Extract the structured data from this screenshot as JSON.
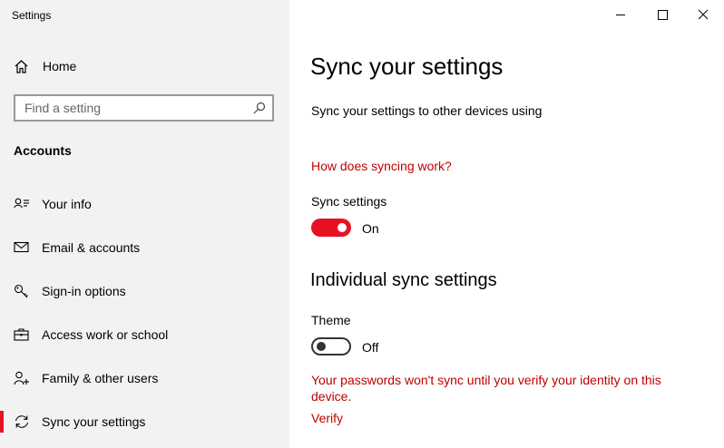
{
  "window": {
    "title": "Settings"
  },
  "sidebar": {
    "home_label": "Home",
    "search_placeholder": "Find a setting",
    "section_title": "Accounts",
    "items": [
      {
        "label": "Your info",
        "icon": "person-card-icon"
      },
      {
        "label": "Email & accounts",
        "icon": "mail-icon"
      },
      {
        "label": "Sign-in options",
        "icon": "key-icon"
      },
      {
        "label": "Access work or school",
        "icon": "briefcase-icon"
      },
      {
        "label": "Family & other users",
        "icon": "person-add-icon"
      },
      {
        "label": "Sync your settings",
        "icon": "sync-icon",
        "active": true
      }
    ]
  },
  "main": {
    "title": "Sync your settings",
    "description": "Sync your settings to other devices using",
    "help_link": "How does syncing work?",
    "sync_settings": {
      "label": "Sync settings",
      "state": "On",
      "on": true
    },
    "individual_heading": "Individual sync settings",
    "theme": {
      "label": "Theme",
      "state": "Off",
      "on": false
    },
    "warning": "Your passwords won't sync until you verify your identity on this device.",
    "verify_link": "Verify"
  },
  "colors": {
    "accent": "#e81123",
    "link": "#c00000",
    "sidebar_bg": "#f2f2f2"
  }
}
